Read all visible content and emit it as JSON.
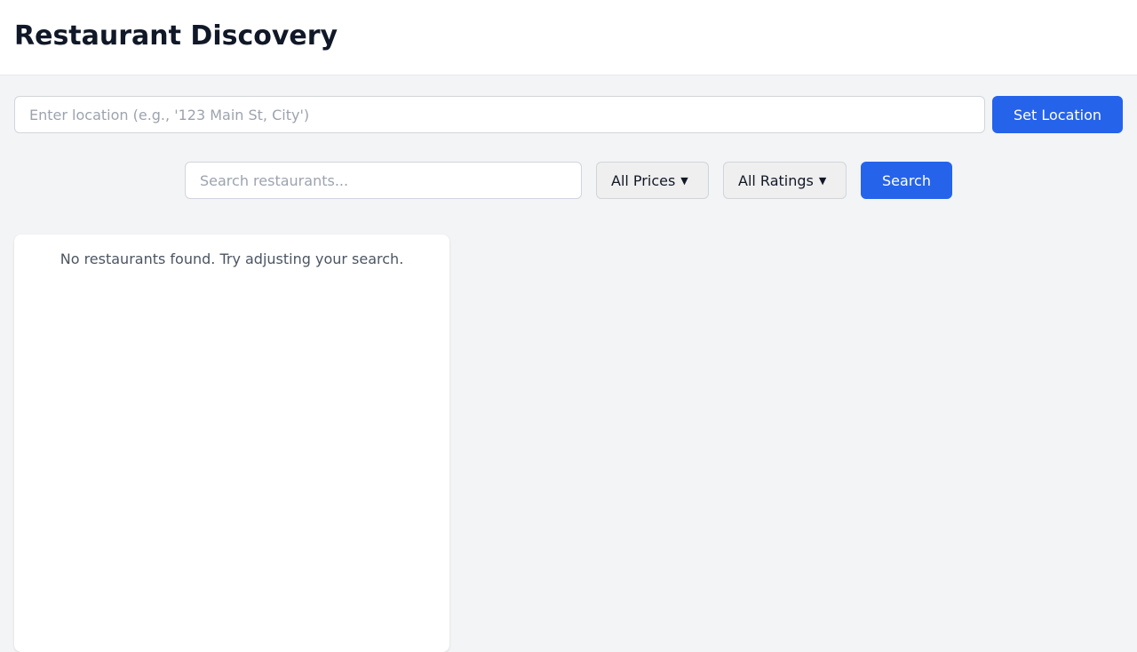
{
  "header": {
    "title": "Restaurant Discovery"
  },
  "location": {
    "placeholder": "Enter location (e.g., '123 Main St, City')",
    "value": "",
    "button_label": "Set Location"
  },
  "search": {
    "placeholder": "Search restaurants...",
    "value": "",
    "price_filter": "All Prices",
    "rating_filter": "All Ratings",
    "button_label": "Search"
  },
  "results": {
    "empty_message": "No restaurants found. Try adjusting your search."
  },
  "colors": {
    "accent": "#2563eb",
    "background": "#f3f4f6"
  }
}
